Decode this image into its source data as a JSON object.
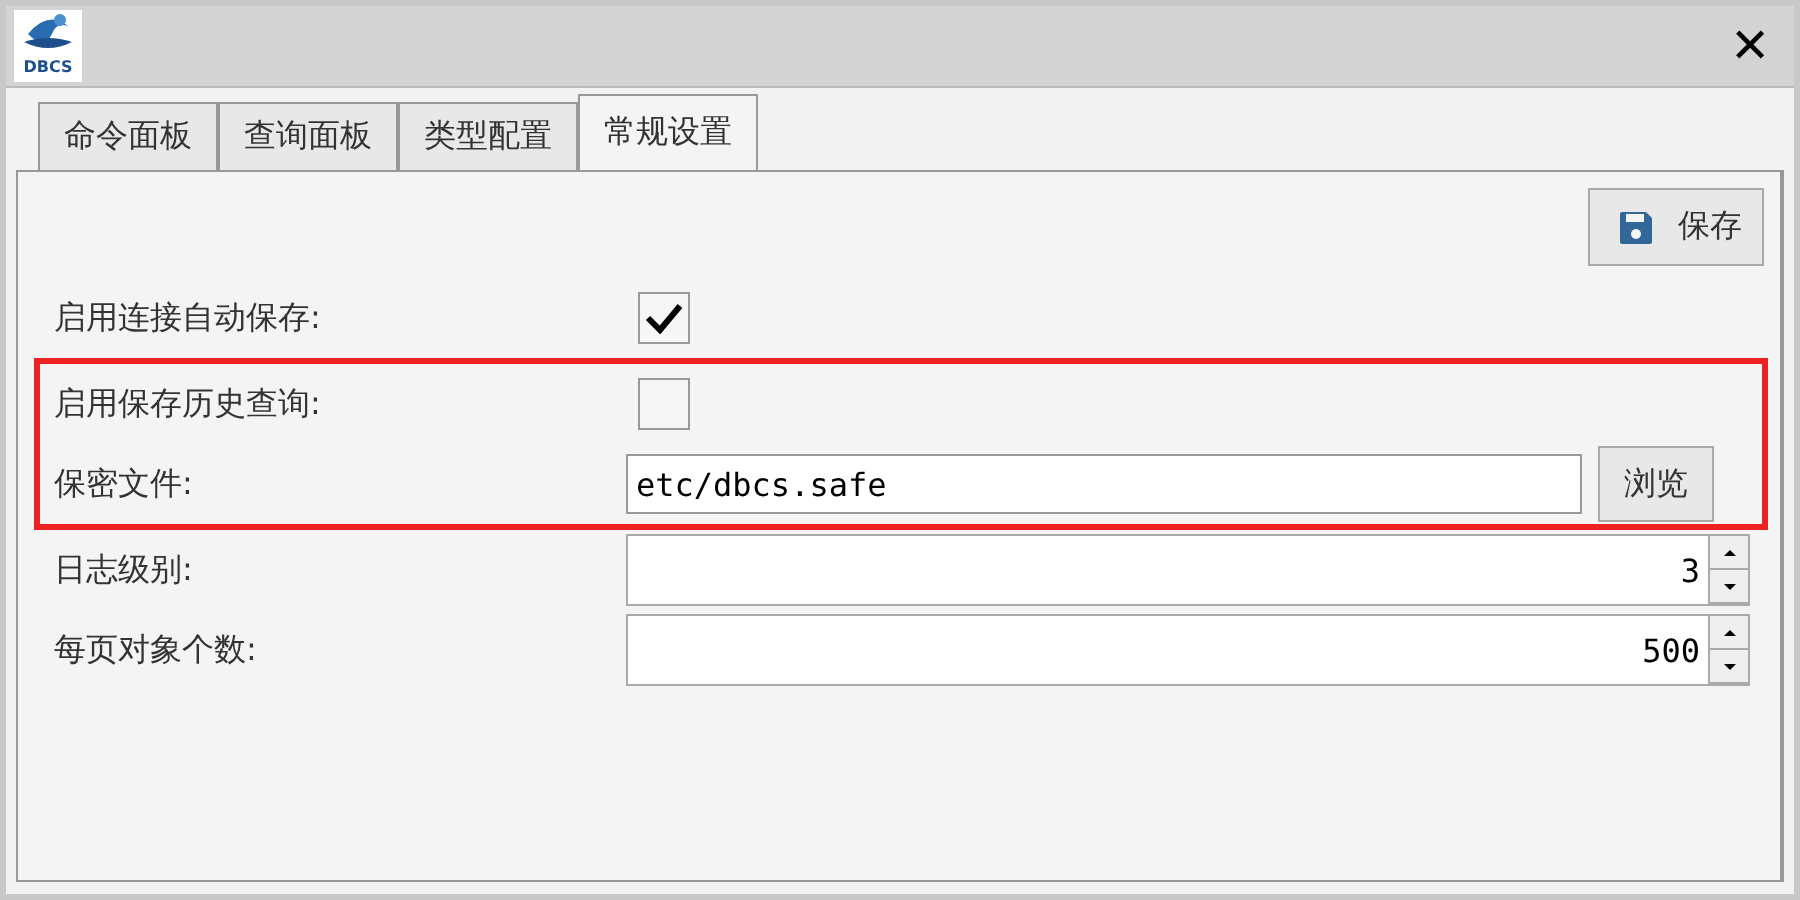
{
  "window": {
    "logo_text": "DBCS",
    "close": "✕"
  },
  "tabs": [
    {
      "label": "命令面板",
      "selected": false
    },
    {
      "label": "查询面板",
      "selected": false
    },
    {
      "label": "类型配置",
      "selected": false
    },
    {
      "label": "常规设置",
      "selected": true
    }
  ],
  "save_button": "保存",
  "settings": [
    {
      "kind": "checkbox",
      "label": "启用连接自动保存:",
      "checked": true,
      "highlighted": false
    },
    {
      "kind": "checkbox",
      "label": "启用保存历史查询:",
      "checked": false,
      "highlighted": true
    },
    {
      "kind": "file",
      "label": "保密文件:",
      "value": "etc/dbcs.safe",
      "button": "浏览",
      "highlighted": true
    },
    {
      "kind": "spinner",
      "label": "日志级别:",
      "value": "3",
      "highlighted": false
    },
    {
      "kind": "spinner",
      "label": "每页对象个数:",
      "value": "500",
      "highlighted": false
    }
  ]
}
